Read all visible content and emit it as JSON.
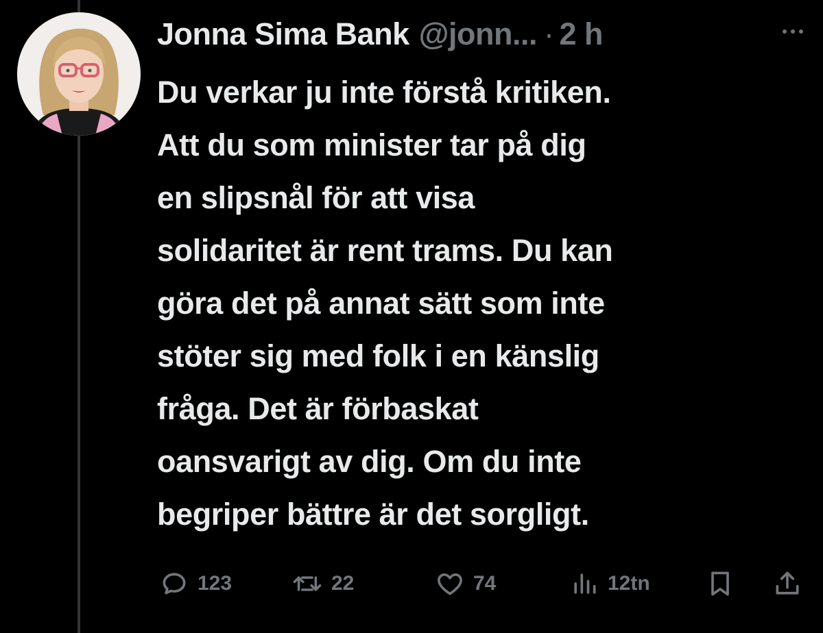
{
  "tweet": {
    "display_name": "Jonna Sima Bank",
    "handle": "@jonn...",
    "separator": "·",
    "time": "2 h",
    "more_icon": "more-horizontal-icon",
    "text_lines": [
      "Du verkar ju inte förstå kritiken.",
      "Att du som minister tar på dig",
      "en slipsnål för att visa",
      "solidaritet är rent trams. Du kan",
      "göra det på annat sätt som inte",
      "stöter sig med folk i en känslig",
      "fråga. Det är förbaskat",
      "oansvarigt av dig. Om du inte",
      "begriper bättre är det sorgligt."
    ]
  },
  "actions": {
    "reply": {
      "icon": "reply-icon",
      "count": "123"
    },
    "retweet": {
      "icon": "retweet-icon",
      "count": "22"
    },
    "like": {
      "icon": "heart-icon",
      "count": "74"
    },
    "views": {
      "icon": "views-chart-icon",
      "count": "12tn"
    },
    "bookmark": {
      "icon": "bookmark-icon"
    },
    "share": {
      "icon": "share-icon"
    }
  },
  "colors": {
    "background": "#000000",
    "primary_text": "#e7e9ea",
    "secondary_text": "#71767b",
    "thread_line": "#333639"
  }
}
